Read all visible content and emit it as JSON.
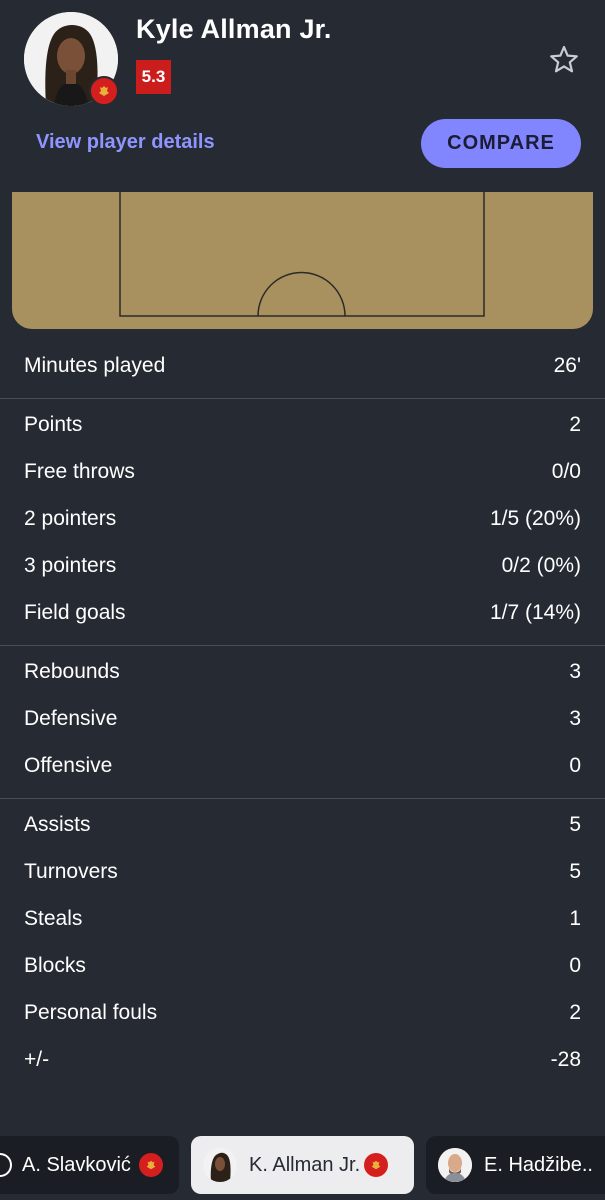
{
  "player": {
    "name": "Kyle Allman Jr.",
    "rating": "5.3",
    "avatar_icon": "player-photo",
    "nationality_icon": "montenegro-flag-icon"
  },
  "actions": {
    "details_label": "View player details",
    "compare_label": "COMPARE",
    "favorite_icon": "star-outline-icon"
  },
  "colors": {
    "background": "#262a33",
    "accent": "#8186ff",
    "rating_bg": "#cc1d1d",
    "court": "#a8915e",
    "link": "#8f95ff"
  },
  "stats": {
    "minutes": [
      {
        "label": "Minutes played",
        "value": "26'"
      }
    ],
    "scoring": [
      {
        "label": "Points",
        "value": "2"
      },
      {
        "label": "Free throws",
        "value": "0/0"
      },
      {
        "label": "2 pointers",
        "value": "1/5 (20%)"
      },
      {
        "label": "3 pointers",
        "value": "0/2 (0%)"
      },
      {
        "label": "Field goals",
        "value": "1/7 (14%)"
      }
    ],
    "rebounds": [
      {
        "label": "Rebounds",
        "value": "3"
      },
      {
        "label": "Defensive",
        "value": "3"
      },
      {
        "label": "Offensive",
        "value": "0"
      }
    ],
    "other": [
      {
        "label": "Assists",
        "value": "5"
      },
      {
        "label": "Turnovers",
        "value": "5"
      },
      {
        "label": "Steals",
        "value": "1"
      },
      {
        "label": "Blocks",
        "value": "0"
      },
      {
        "label": "Personal fouls",
        "value": "2"
      },
      {
        "label": "+/-",
        "value": "-28"
      }
    ]
  },
  "player_selector": [
    {
      "name": "A. Slavković",
      "active": false
    },
    {
      "name": "K. Allman Jr.",
      "active": true
    },
    {
      "name": "E. Hadžibe..",
      "active": false
    }
  ]
}
